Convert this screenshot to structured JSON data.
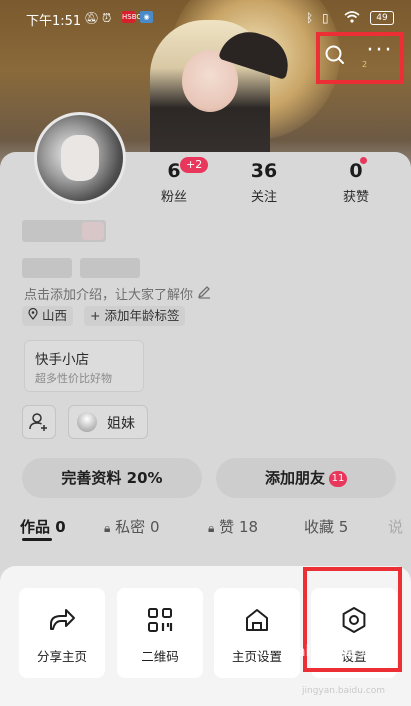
{
  "status_bar": {
    "time": "下午1:51",
    "battery": "49",
    "app_badge_1": "HSBC"
  },
  "header": {
    "level_badge": "2"
  },
  "profile": {
    "stats": [
      {
        "value": "6",
        "label": "粉丝",
        "badge": "+2"
      },
      {
        "value": "36",
        "label": "关注"
      },
      {
        "value": "0",
        "label": "获赞"
      }
    ],
    "bio_placeholder": "点击添加介绍，让大家了解你",
    "location_tag": "山西",
    "age_tag": "+ 添加年龄标签",
    "shop": {
      "title": "快手小店",
      "subtitle": "超多性价比好物"
    },
    "relation_label": "姐妹",
    "buttons": {
      "complete_profile": "完善资料 20%",
      "add_friends": "添加朋友",
      "add_friends_badge": "11"
    },
    "tabs": [
      {
        "label": "作品 0"
      },
      {
        "label": "私密 0"
      },
      {
        "label": "赞 18"
      },
      {
        "label": "收藏 5"
      },
      {
        "label": "说"
      }
    ]
  },
  "sheet": {
    "items": [
      {
        "label": "分享主页",
        "icon": "share-icon"
      },
      {
        "label": "二维码",
        "icon": "qr-code-icon"
      },
      {
        "label": "主页设置",
        "icon": "home-icon"
      },
      {
        "label": "设置",
        "icon": "settings-hexagon-icon"
      }
    ]
  },
  "watermark": {
    "text": "Bai du 经验",
    "sub": "jingyan.baidu.com"
  },
  "colors": {
    "accent_red": "#e8375b",
    "highlight_frame": "#ec2e35"
  }
}
